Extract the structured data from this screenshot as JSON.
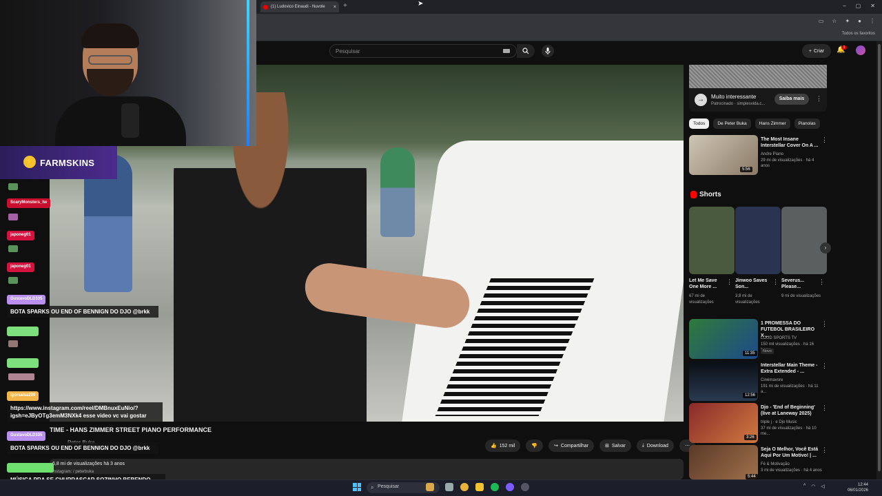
{
  "browser": {
    "tab_title": "(1) Ludovico Einaudi - Nuvole",
    "bookmarks_label": "Todos os favoritos"
  },
  "youtube": {
    "search_placeholder": "Pesquisar",
    "create_label": "Criar",
    "notification_count": "1"
  },
  "video": {
    "title": "TIME - HANS ZIMMER STREET PIANO PERFORMANCE",
    "channel": "Peter Buka",
    "likes": "152 mil",
    "share": "Compartilhar",
    "save": "Salvar",
    "download": "Download",
    "views_line": "6,8 mi de visualizações  há 3 anos",
    "desc_line": "Instagram: / peterbuka"
  },
  "overlay": {
    "sponsor": "FARMSKINS",
    "chat": [
      {
        "name": "ScaryMonsters_tw",
        "color": "#c8102e",
        "msg": ""
      },
      {
        "name": "japoneg01",
        "color": "#d3123f",
        "msg": ""
      },
      {
        "name": "japoneg01",
        "color": "#d3123f",
        "msg": ""
      },
      {
        "name": "GustavoDLD335",
        "color": "#b98ff0",
        "msg": "BOTA SPARKS OU END OF BENNIGN DO DJO @brkk"
      },
      {
        "name": "lgorsalsa299",
        "color": "#f3b54a",
        "msg": "https://www.instagram.com/reel/DMBnuxEuNio/?igsh=eJByOTg3emM3NXk4 esse video vc vai gostar"
      },
      {
        "name": "GustavoDLD335",
        "color": "#b98ff0",
        "msg": "BOTA SPARKS OU END OF BENNIGN DO DJO @brkk"
      },
      {
        "name": "",
        "color": "#6ee06e",
        "msg": "MÚSICA PRA SE CHURRASCAR SOZINHO BEBENDO VINHO"
      }
    ]
  },
  "sidebar": {
    "ad": {
      "title": "Muito interessante",
      "sponsored": "Patrocinado · simplesvida.c...",
      "button": "Saiba mais"
    },
    "chips": [
      "Todos",
      "De Peter Buka",
      "Hans Zimmer",
      "Pianolas"
    ],
    "top_video": {
      "title": "The Most Insane Interstellar Cover On A ...",
      "channel": "Andre Piano",
      "meta": "29 mi de visualizações · há 4 anos",
      "duration": "5:56"
    },
    "shorts_heading": "Shorts",
    "shorts": [
      {
        "title": "Let Me Save One More ...",
        "views": "67 mi de visualizações",
        "color": "#4a5a3e"
      },
      {
        "title": "Jinwoo Saves Son...",
        "views": "3,8 mi de visualizações",
        "color": "#2a3450"
      },
      {
        "title": "Severus... Please...",
        "views": "9 mi de visualizações",
        "color": "#5a6060"
      }
    ],
    "videos": [
      {
        "title": "1 PROMESSA DO FUTEBOL BRASILEIRO X ...",
        "channel": "LOUD SPORTS TV",
        "meta": "150 mil visualizações · há 16 horas",
        "badge": "Novo",
        "duration": "11:35",
        "thumb": "#2f7a3a"
      },
      {
        "title": "Interstellar Main Theme - Extra Extended - ...",
        "channel": "Cinémavore",
        "meta": "191 mi de visualizações · há 11 a...",
        "badge": "",
        "duration": "12:56",
        "thumb": "#1a2430"
      },
      {
        "title": "Djo - 'End of Beginning' (live at Laneway 2025)",
        "channel": "triple j · e Djo Music",
        "meta": "37 mi de visualizações · há 10 me...",
        "badge": "",
        "duration": "3:26",
        "thumb": "#8a2a2a"
      },
      {
        "title": "Seja O Melhor, Você Está Aqui Por Um Motivo! | ...",
        "channel": "Fé & Motivação",
        "meta": "3 mi de visualizações · há 4 anos",
        "badge": "",
        "duration": "5:44",
        "thumb": "#5a3a28"
      }
    ]
  },
  "taskbar": {
    "search": "Pesquisar",
    "time": "12:44",
    "date": "06/01/2026"
  }
}
